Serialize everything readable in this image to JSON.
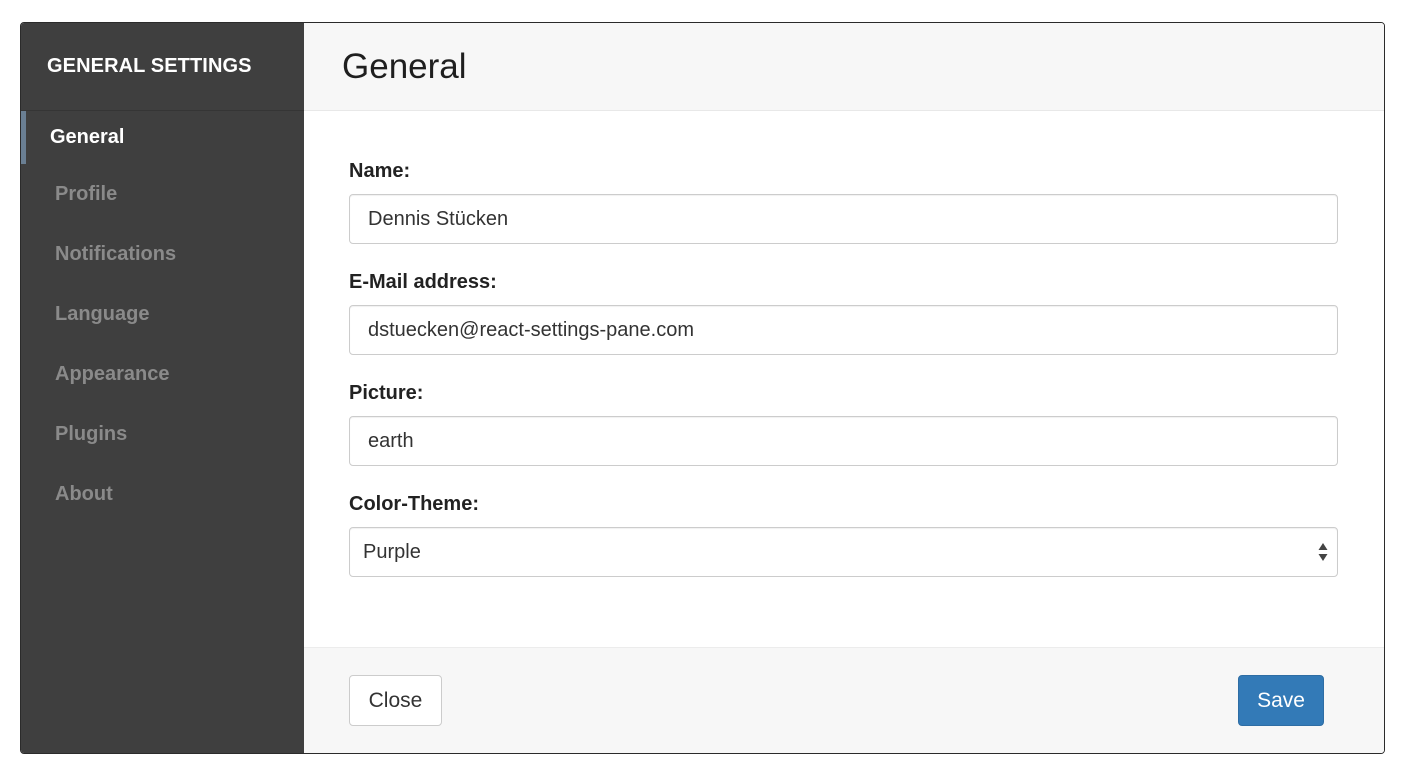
{
  "sidebar": {
    "title": "GENERAL SETTINGS",
    "items": [
      {
        "label": "General",
        "active": true
      },
      {
        "label": "Profile",
        "active": false
      },
      {
        "label": "Notifications",
        "active": false
      },
      {
        "label": "Language",
        "active": false
      },
      {
        "label": "Appearance",
        "active": false
      },
      {
        "label": "Plugins",
        "active": false
      },
      {
        "label": "About",
        "active": false
      }
    ]
  },
  "main": {
    "title": "General",
    "fields": {
      "name": {
        "label": "Name:",
        "value": "Dennis Stücken"
      },
      "email": {
        "label": "E-Mail address:",
        "value": "dstuecken@react-settings-pane.com"
      },
      "picture": {
        "label": "Picture:",
        "value": "earth"
      },
      "color_theme": {
        "label": "Color-Theme:",
        "value": "Purple"
      }
    }
  },
  "footer": {
    "close_label": "Close",
    "save_label": "Save"
  },
  "colors": {
    "sidebar_bg": "#3f3f3f",
    "active_indicator": "#6a7f93",
    "primary": "#337ab7"
  }
}
